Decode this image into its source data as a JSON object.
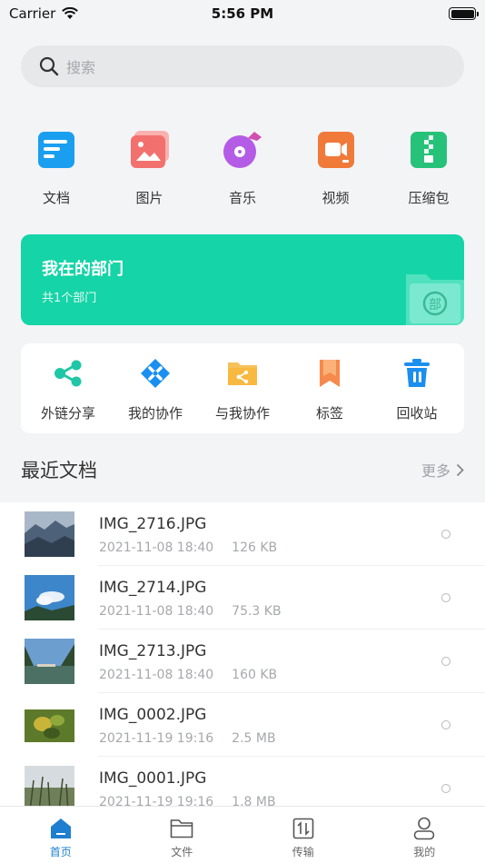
{
  "status_bar": {
    "carrier": "Carrier",
    "time": "5:56 PM"
  },
  "search": {
    "placeholder": "搜索"
  },
  "categories": [
    {
      "label": "文档",
      "icon": "document-icon",
      "color": "#1a9ff0"
    },
    {
      "label": "图片",
      "icon": "image-icon",
      "color": "#f2716e"
    },
    {
      "label": "音乐",
      "icon": "music-disc-icon",
      "color": "#b45ce6"
    },
    {
      "label": "视频",
      "icon": "video-icon",
      "color": "#f07a3a"
    },
    {
      "label": "压缩包",
      "icon": "zip-icon",
      "color": "#27c27a"
    }
  ],
  "department": {
    "title": "我在的部门",
    "subtitle": "共1个部门",
    "badge": "部",
    "color": "#15d4a7"
  },
  "tools": [
    {
      "label": "外链分享",
      "icon": "share-icon"
    },
    {
      "label": "我的协作",
      "icon": "collaboration-icon"
    },
    {
      "label": "与我协作",
      "icon": "shared-folder-icon"
    },
    {
      "label": "标签",
      "icon": "bookmark-icon"
    },
    {
      "label": "回收站",
      "icon": "trash-icon"
    }
  ],
  "recent": {
    "title": "最近文档",
    "more": "更多",
    "files": [
      {
        "name": "IMG_2716.JPG",
        "date": "2021-11-08 18:40",
        "size": "126 KB",
        "thumb": "mountains"
      },
      {
        "name": "IMG_2714.JPG",
        "date": "2021-11-08 18:40",
        "size": "75.3 KB",
        "thumb": "sky-cloud"
      },
      {
        "name": "IMG_2713.JPG",
        "date": "2021-11-08 18:40",
        "size": "160 KB",
        "thumb": "lake"
      },
      {
        "name": "IMG_0002.JPG",
        "date": "2021-11-19 19:16",
        "size": "2.5 MB",
        "thumb": "plant"
      },
      {
        "name": "IMG_0001.JPG",
        "date": "2021-11-19 19:16",
        "size": "1.8 MB",
        "thumb": "grass"
      }
    ]
  },
  "tabbar": [
    {
      "label": "首页",
      "icon": "home-icon",
      "active": true
    },
    {
      "label": "文件",
      "icon": "folder-icon",
      "active": false
    },
    {
      "label": "传输",
      "icon": "transfer-icon",
      "active": false
    },
    {
      "label": "我的",
      "icon": "profile-icon",
      "active": false
    }
  ],
  "colors": {
    "accent": "#1e7fd1",
    "teal": "#15d4a7",
    "tool_icon": "#1fc7a6"
  }
}
